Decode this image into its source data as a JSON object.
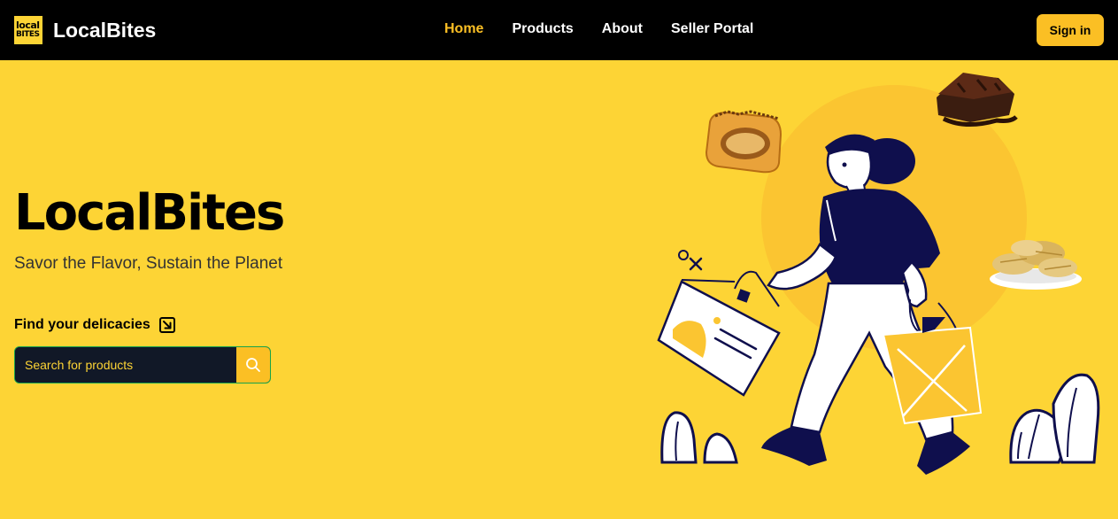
{
  "header": {
    "logo_text_line1": "local",
    "logo_text_line2": "BITES",
    "brand": "LocalBites",
    "nav": [
      {
        "label": "Home",
        "active": true
      },
      {
        "label": "Products",
        "active": false
      },
      {
        "label": "About",
        "active": false
      },
      {
        "label": "Seller Portal",
        "active": false
      }
    ],
    "signin_label": "Sign in"
  },
  "hero": {
    "title": "LocalBites",
    "subtitle": "Savor the Flavor, Sustain the Planet",
    "find_label": "Find your delicacies"
  },
  "search": {
    "placeholder": "Search for products",
    "value": ""
  },
  "icons": {
    "logo": "localbites-logo-icon",
    "find_arrow": "arrow-down-right-icon",
    "search": "search-icon"
  },
  "colors": {
    "background": "#fdd435",
    "header": "#000000",
    "accent": "#fbbf24",
    "search_bg": "#111827",
    "illustration_navy": "#0f0f4d"
  }
}
